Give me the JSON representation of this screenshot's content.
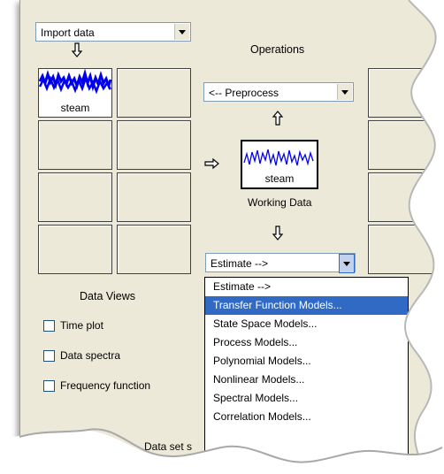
{
  "import_combo": {
    "value": "Import data"
  },
  "operations": {
    "heading": "Operations",
    "preprocess_value": "<-- Preprocess",
    "estimate_value": "Estimate -->"
  },
  "data_views": {
    "heading": "Data Views",
    "checkboxes": [
      {
        "label": "Time plot",
        "checked": false
      },
      {
        "label": "Data spectra",
        "checked": false
      },
      {
        "label": "Frequency function",
        "checked": false
      }
    ]
  },
  "data_boards": {
    "slot1_label": "steam"
  },
  "working_data": {
    "name": "steam",
    "caption": "Working Data"
  },
  "estimate_menu": {
    "options": [
      "Estimate -->",
      "Transfer Function Models...",
      "State Space Models...",
      "Process Models...",
      "Polynomial Models...",
      "Nonlinear Models...",
      "Spectral Models...",
      "Correlation Models..."
    ],
    "selected_index": 1
  },
  "footer": {
    "partial_label": "Data set s"
  },
  "colors": {
    "signal": "#0000ee",
    "panel": "#ece9d8",
    "selection": "#316ac5"
  }
}
